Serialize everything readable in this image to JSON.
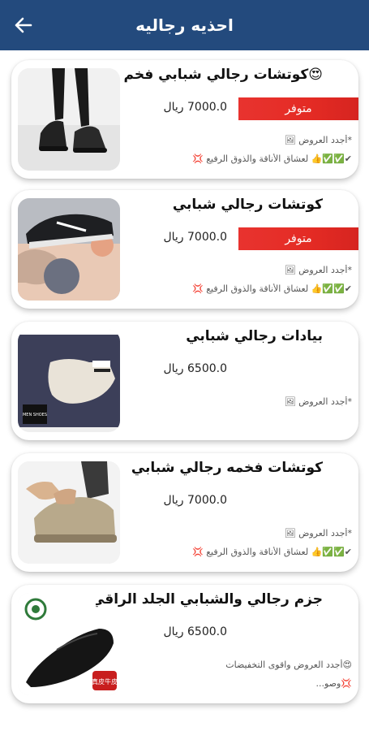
{
  "header": {
    "title": "احذيه رجاليه",
    "back_icon": "arrow-left-icon",
    "background": "#234a7d"
  },
  "products": [
    {
      "title": "😍كوتشات رجالي شبابي  فخم",
      "price": "7000.0 ريال",
      "badge": "متوفر",
      "notes": [
        "*أجدد العروض 🖼",
        "✔✅✅👍 لعشاق الأناقة والذوق الرفيع 💢"
      ]
    },
    {
      "title": "كوتشات رجالي شبابي",
      "price": "7000.0 ريال",
      "badge": "متوفر",
      "notes": [
        "*أجدد العروض 🖼",
        "✔✅✅👍 لعشاق الأناقة والذوق الرفيع 💢"
      ]
    },
    {
      "title": "بيادات رجالي شبابي",
      "price": "6500.0 ريال",
      "badge": "",
      "notes": [
        "*أجدد العروض 🖼"
      ]
    },
    {
      "title": "كوتشات فخمه رجالي شبابي",
      "price": "7000.0 ريال",
      "badge": "",
      "notes": [
        "*أجدد العروض 🖼",
        "✔✅✅👍 لعشاق الأناقة والذوق الرفيع 💢"
      ]
    },
    {
      "title": "جزم رجالي والشبابي الجلد الراقي ...",
      "price": "6500.0 ريال",
      "badge": "",
      "notes": [
        "😍أجدد العروض واقوى التخفيضات",
        "💢وصو..."
      ]
    }
  ],
  "image_text": {
    "thumb3_box": "MEN SHOES",
    "thumb5_logo": "真皮牛皮"
  },
  "colors": {
    "badge_red": "#e42b24",
    "header_blue": "#234a7d"
  }
}
